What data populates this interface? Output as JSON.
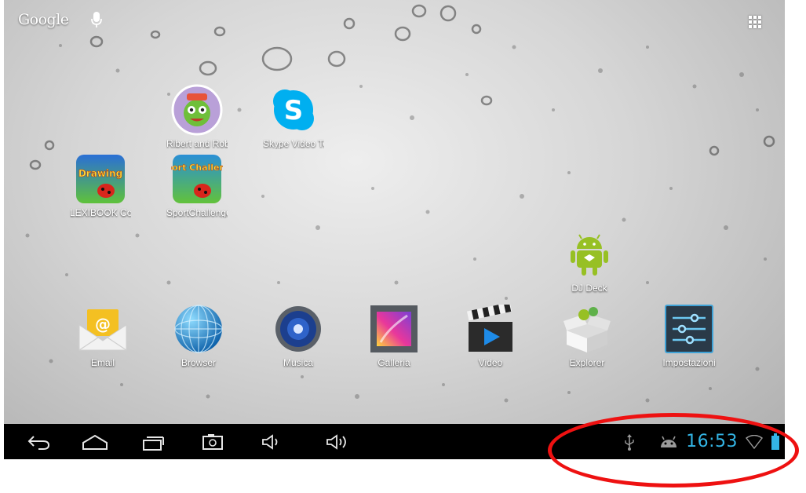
{
  "search": {
    "logo_text": "Google",
    "mic_icon": "mic-icon"
  },
  "all_apps_icon": "apps-grid-icon",
  "desktop_apps": [
    {
      "label": "Ribert and Robe",
      "icon": "robot-character-icon"
    },
    {
      "label": "Skype Video Te",
      "icon": "skype-icon"
    },
    {
      "label": "LEXIBOOK Con",
      "icon": "lexibook-drawing-icon",
      "icon_text": "Drawing"
    },
    {
      "label": "SportChallenge",
      "icon": "sport-challenge-icon",
      "icon_text": "Sport Challenge"
    },
    {
      "label": "DJ Deck",
      "icon": "android-robot-icon"
    }
  ],
  "dock_apps": [
    {
      "label": "Email",
      "icon": "email-envelope-icon"
    },
    {
      "label": "Browser",
      "icon": "globe-icon"
    },
    {
      "label": "Musica",
      "icon": "speaker-icon"
    },
    {
      "label": "Galleria",
      "icon": "gallery-icon"
    },
    {
      "label": "Video",
      "icon": "clapperboard-icon"
    },
    {
      "label": "Explorer",
      "icon": "box-icon"
    },
    {
      "label": "Impostazioni",
      "icon": "settings-sliders-icon"
    }
  ],
  "navbar": {
    "buttons": [
      "back-icon",
      "home-icon",
      "recent-apps-icon",
      "screenshot-icon",
      "volume-down-icon",
      "volume-up-icon"
    ]
  },
  "status": {
    "time": "16:53",
    "icons": [
      "usb-icon",
      "android-debug-icon",
      "wifi-icon",
      "battery-icon"
    ],
    "accent_color": "#33b5e5"
  },
  "annotation": {
    "color": "#ee1111",
    "shape": "ellipse"
  }
}
